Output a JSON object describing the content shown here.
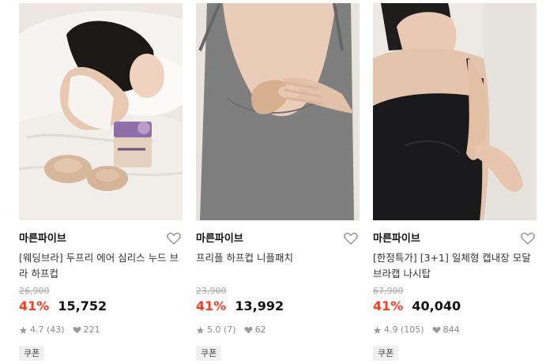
{
  "colors": {
    "discount": "#ff3b1f",
    "price": "#111111",
    "muted": "#8a8a8a"
  },
  "products": [
    {
      "brand": "마른파이브",
      "title": "[웨딩브라] 두프리 에어 심리스 누드 브라 하프컵",
      "original_price": "26,900",
      "discount": "41%",
      "price": "15,752",
      "rating": "4.7",
      "reviews": "(43)",
      "likes": "221",
      "badge": "쿠폰",
      "image_icon": "woman-lying-in-bed-with-product-box-photo"
    },
    {
      "brand": "마른파이브",
      "title": "프리플 하프컵 니플패치",
      "original_price": "23,900",
      "discount": "41%",
      "price": "13,992",
      "rating": "5.0",
      "reviews": "(7)",
      "likes": "62",
      "badge": "쿠폰",
      "image_icon": "gray-camisole-with-nude-patch-photo"
    },
    {
      "brand": "마른파이브",
      "title": "[한정특가] [3+1] 일체형 캡내장 모달 브라캡 나시탑",
      "original_price": "67,900",
      "discount": "41%",
      "price": "40,040",
      "rating": "4.9",
      "reviews": "(105)",
      "likes": "844",
      "badge": "쿠폰",
      "image_icon": "woman-in-black-cami-top-photo"
    }
  ]
}
